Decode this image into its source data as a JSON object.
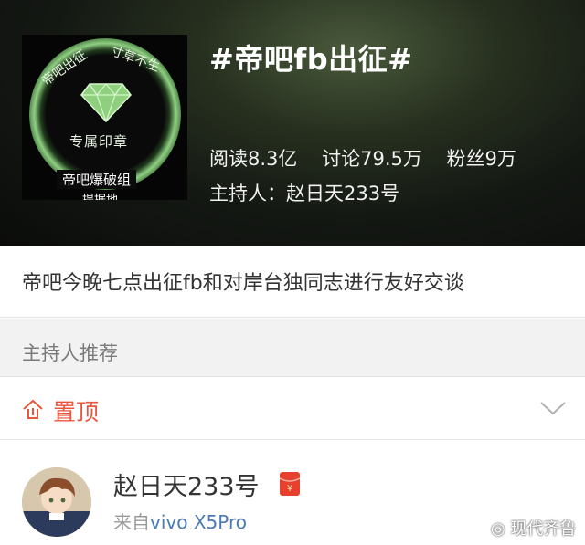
{
  "topic": {
    "title": "#帝吧fb出征#",
    "cover": {
      "ring_text_left": "帝吧出征",
      "ring_text_right": "寸草不生",
      "seal_text": "专属印章",
      "group_text": "帝吧爆破组",
      "cut_text": "提据地"
    },
    "stats": {
      "reads": "阅读8.3亿",
      "discussions": "讨论79.5万",
      "fans": "粉丝9万"
    },
    "host": "主持人：赵日天233号",
    "description": "帝吧今晚七点出征fb和对岸台独同志进行友好交谈"
  },
  "section": {
    "label": "主持人推荐"
  },
  "pinned": {
    "label": "置顶",
    "icon": "pin-top-icon",
    "color": "#e8563d"
  },
  "post": {
    "username": "赵日天233号",
    "source_prefix": "来自",
    "device": "vivo X5Pro",
    "badge_icon": "red-packet-icon"
  },
  "watermark": "现代齐鲁",
  "colors": {
    "accent": "#e8563d",
    "link": "#4b79b6"
  }
}
